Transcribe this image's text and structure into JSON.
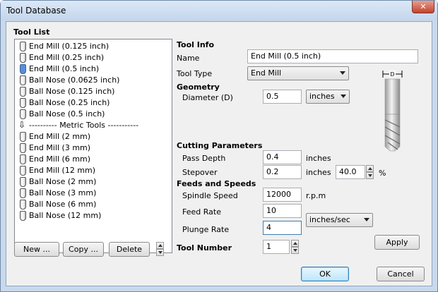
{
  "window": {
    "title": "Tool Database",
    "close_glyph": "✕"
  },
  "tool_list": {
    "label": "Tool List",
    "items": [
      {
        "label": "End Mill (0.125 inch)",
        "icon": "end-mill-icon"
      },
      {
        "label": "End Mill (0.25 inch)",
        "icon": "end-mill-icon"
      },
      {
        "label": "End Mill (0.5 inch)",
        "icon": "end-mill-icon",
        "selected": true
      },
      {
        "label": "Ball Nose (0.0625 inch)",
        "icon": "ball-nose-icon"
      },
      {
        "label": "Ball Nose (0.125 inch)",
        "icon": "ball-nose-icon"
      },
      {
        "label": "Ball Nose (0.25 inch)",
        "icon": "ball-nose-icon"
      },
      {
        "label": "Ball Nose (0.5 inch)",
        "icon": "ball-nose-icon"
      },
      {
        "label": "---------- Metric Tools -----------",
        "icon": "divider-arrow-icon"
      },
      {
        "label": "End Mill (2 mm)",
        "icon": "end-mill-icon"
      },
      {
        "label": "End Mill (3 mm)",
        "icon": "end-mill-icon"
      },
      {
        "label": "End Mill (6 mm)",
        "icon": "end-mill-icon"
      },
      {
        "label": "End Mill (12 mm)",
        "icon": "end-mill-icon"
      },
      {
        "label": "Ball Nose (2 mm)",
        "icon": "ball-nose-icon"
      },
      {
        "label": "Ball Nose (3 mm)",
        "icon": "ball-nose-icon"
      },
      {
        "label": "Ball Nose (6 mm)",
        "icon": "ball-nose-icon"
      },
      {
        "label": "Ball Nose (12 mm)",
        "icon": "ball-nose-icon"
      }
    ],
    "buttons": {
      "new": "New ...",
      "copy": "Copy ...",
      "delete": "Delete"
    }
  },
  "tool_info": {
    "heading": "Tool Info",
    "name_label": "Name",
    "name_value": "End Mill (0.5 inch)",
    "type_label": "Tool Type",
    "type_value": "End Mill",
    "geometry_heading": "Geometry",
    "diameter_label": "Diameter (D)",
    "diameter_value": "0.5",
    "diameter_units": "inches",
    "diagram_label": "D"
  },
  "cutting": {
    "heading": "Cutting Parameters",
    "pass_depth_label": "Pass Depth",
    "pass_depth_value": "0.4",
    "pass_depth_units": "inches",
    "stepover_label": "Stepover",
    "stepover_value": "0.2",
    "stepover_units": "inches",
    "stepover_percent": "40.0",
    "percent_sign": "%"
  },
  "feeds": {
    "heading": "Feeds and Speeds",
    "spindle_label": "Spindle Speed",
    "spindle_value": "12000",
    "spindle_units": "r.p.m",
    "feed_label": "Feed Rate",
    "feed_value": "10",
    "plunge_label": "Plunge Rate",
    "plunge_value": "4",
    "rate_units": "inches/sec"
  },
  "tool_number": {
    "label": "Tool Number",
    "value": "1"
  },
  "actions": {
    "apply": "Apply",
    "ok": "OK",
    "cancel": "Cancel"
  }
}
